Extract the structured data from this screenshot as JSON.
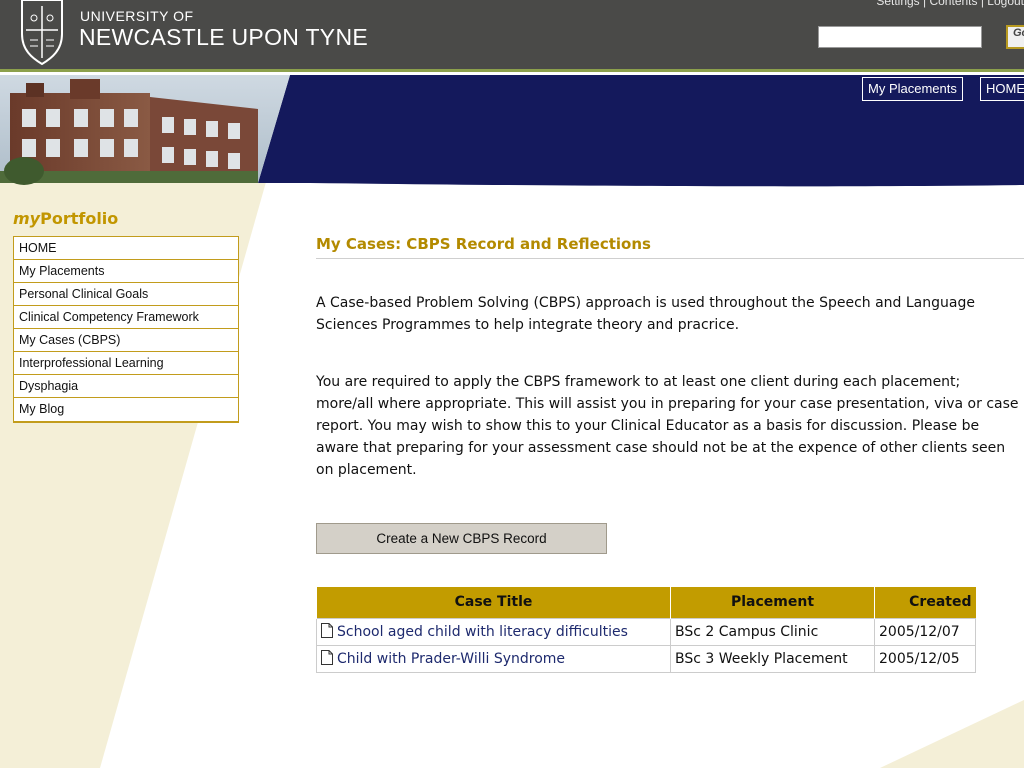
{
  "header": {
    "university_line1": "UNIVERSITY OF",
    "university_line2": "NEWCASTLE UPON TYNE",
    "top_links": [
      "Settings",
      "Contents",
      "Logout"
    ],
    "search_value": "",
    "go_label": "Go"
  },
  "nav": {
    "tabs": [
      {
        "label": "My Placements"
      },
      {
        "label": "HOME"
      }
    ]
  },
  "sidebar": {
    "title_prefix": "my",
    "title_suffix": "Portfolio",
    "items": [
      {
        "label": "HOME"
      },
      {
        "label": "My Placements"
      },
      {
        "label": "Personal Clinical Goals"
      },
      {
        "label": "Clinical Competency Framework"
      },
      {
        "label": "My Cases (CBPS)"
      },
      {
        "label": "Interprofessional Learning"
      },
      {
        "label": "Dysphagia"
      },
      {
        "label": "My Blog"
      }
    ]
  },
  "main": {
    "title": "My Cases: CBPS Record and Reflections",
    "intro": "A Case-based Problem Solving (CBPS) approach is used throughout the Speech and Language Sciences Programmes to help integrate theory and pracrice.",
    "requirement": "You are required to apply the CBPS framework to at least one client during each placement; more/all where appropriate. This will assist you in preparing for your case presentation, viva or case report. You may wish to show this to your Clinical Educator as a basis for discussion. Please be aware that preparing for your assessment case should not be at the expence of other clients seen on placement.",
    "create_button": "Create a New CBPS Record",
    "table": {
      "headers": [
        "Case Title",
        "Placement",
        "Created"
      ],
      "rows": [
        {
          "title": "School aged child with literacy difficulties",
          "placement": "BSc 2 Campus Clinic",
          "created": "2005/12/07"
        },
        {
          "title": "Child with Prader-Willi Syndrome",
          "placement": "BSc 3 Weekly Placement",
          "created": "2005/12/05"
        }
      ]
    }
  },
  "colors": {
    "header_bg": "#4a4a48",
    "accent_gold": "#c29c00",
    "navy": "#14195c",
    "cream": "#f4efd7"
  }
}
